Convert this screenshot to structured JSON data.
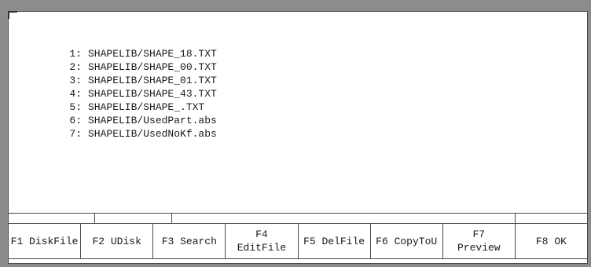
{
  "file_list": [
    {
      "index": "1:",
      "path": "SHAPELIB/SHAPE_18.TXT"
    },
    {
      "index": "2:",
      "path": "SHAPELIB/SHAPE_00.TXT"
    },
    {
      "index": "3:",
      "path": "SHAPELIB/SHAPE_01.TXT"
    },
    {
      "index": "4:",
      "path": "SHAPELIB/SHAPE_43.TXT"
    },
    {
      "index": "5:",
      "path": "SHAPELIB/SHAPE_.TXT"
    },
    {
      "index": "6:",
      "path": "SHAPELIB/UsedPart.abs"
    },
    {
      "index": "7:",
      "path": "SHAPELIB/UsedNoKf.abs"
    }
  ],
  "function_keys": [
    {
      "label": "F1 DiskFile"
    },
    {
      "label": "F2 UDisk"
    },
    {
      "label": "F3 Search"
    },
    {
      "label": "F4\nEditFile"
    },
    {
      "label": "F5 DelFile"
    },
    {
      "label": "F6 CopyToU"
    },
    {
      "label": "F7\nPreview"
    },
    {
      "label": "F8 OK"
    }
  ],
  "colors": {
    "frame": "#8c8c8c",
    "border": "#4a4a4a",
    "background": "#ffffff",
    "text": "#1a1a1a"
  }
}
